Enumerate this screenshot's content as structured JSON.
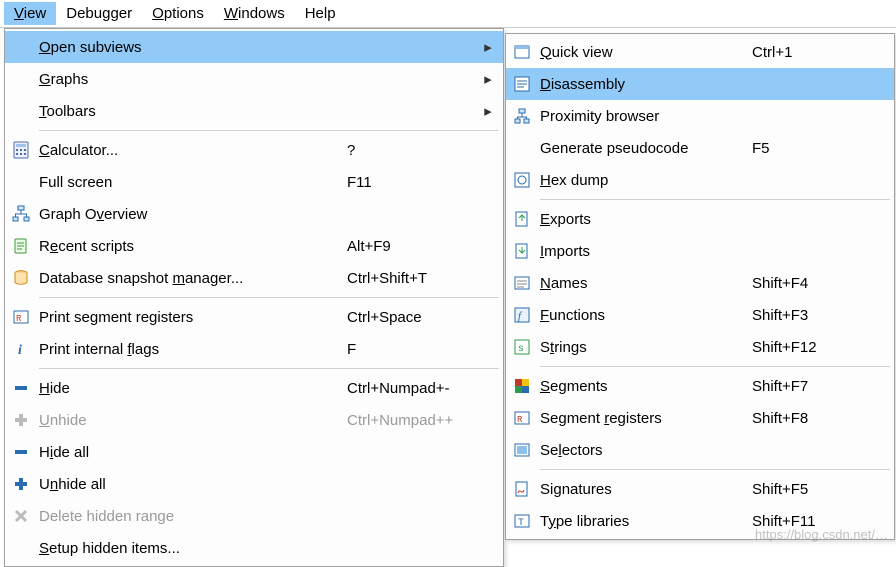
{
  "menubar": {
    "view": "View",
    "debugger": "Debugger",
    "options": "Options",
    "windows": "Windows",
    "help": "Help"
  },
  "menu": {
    "open_subviews": "Open subviews",
    "graphs": "Graphs",
    "toolbars": "Toolbars",
    "calculator": "Calculator...",
    "calculator_sc": "?",
    "full_screen": "Full screen",
    "full_screen_sc": "F11",
    "graph_overview": "Graph Overview",
    "recent_scripts": "Recent scripts",
    "recent_scripts_sc": "Alt+F9",
    "db_snapshot": "Database snapshot manager...",
    "db_snapshot_sc": "Ctrl+Shift+T",
    "print_seg_reg": "Print segment registers",
    "print_seg_reg_sc": "Ctrl+Space",
    "print_int_flags": "Print internal flags",
    "print_int_flags_sc": "F",
    "hide": "Hide",
    "hide_sc": "Ctrl+Numpad+-",
    "unhide": "Unhide",
    "unhide_sc": "Ctrl+Numpad++",
    "hide_all": "Hide all",
    "unhide_all": "Unhide all",
    "delete_hidden_range": "Delete hidden range",
    "setup_hidden_items": "Setup hidden items..."
  },
  "submenu": {
    "quick_view": "Quick view",
    "quick_view_sc": "Ctrl+1",
    "disassembly": "Disassembly",
    "proximity_browser": "Proximity browser",
    "generate_pseudocode": "Generate pseudocode",
    "generate_pseudocode_sc": "F5",
    "hex_dump": "Hex dump",
    "exports": "Exports",
    "imports": "Imports",
    "names": "Names",
    "names_sc": "Shift+F4",
    "functions": "Functions",
    "functions_sc": "Shift+F3",
    "strings": "Strings",
    "strings_sc": "Shift+F12",
    "segments": "Segments",
    "segments_sc": "Shift+F7",
    "segment_registers": "Segment registers",
    "segment_registers_sc": "Shift+F8",
    "selectors": "Selectors",
    "signatures": "Signatures",
    "signatures_sc": "Shift+F5",
    "type_libraries": "Type libraries",
    "type_libraries_sc": "Shift+F11"
  },
  "watermark": "https://blog.csdn.net/…"
}
